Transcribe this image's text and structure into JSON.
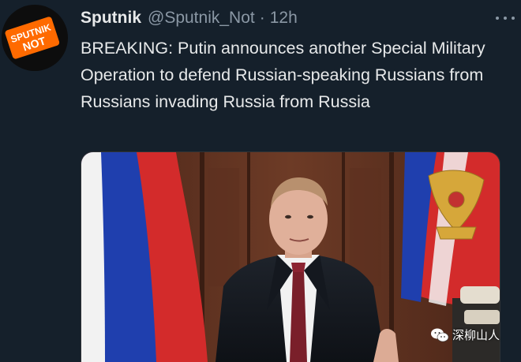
{
  "tweet": {
    "avatar_text": "SPUTNIK NOT",
    "display_name": "Sputnik",
    "handle": "@Sputnik_Not",
    "separator": "·",
    "timestamp": "12h",
    "text": "BREAKING: Putin announces another Special Military Operation to defend Russian-speaking Russians from Russians invading Russia from Russia",
    "more_icon": "more-dots-icon",
    "media_description_icon": "photo"
  },
  "watermark": {
    "text": "深柳山人",
    "icon": "wechat-icon"
  },
  "colors": {
    "background": "#15202b",
    "primary_text": "#e7e9ea",
    "secondary_text": "#8b98a5",
    "avatar_accent": "#ff6a00",
    "flag_white": "#f2f2f2",
    "flag_blue": "#1f3fae",
    "flag_red": "#d32b2b"
  }
}
